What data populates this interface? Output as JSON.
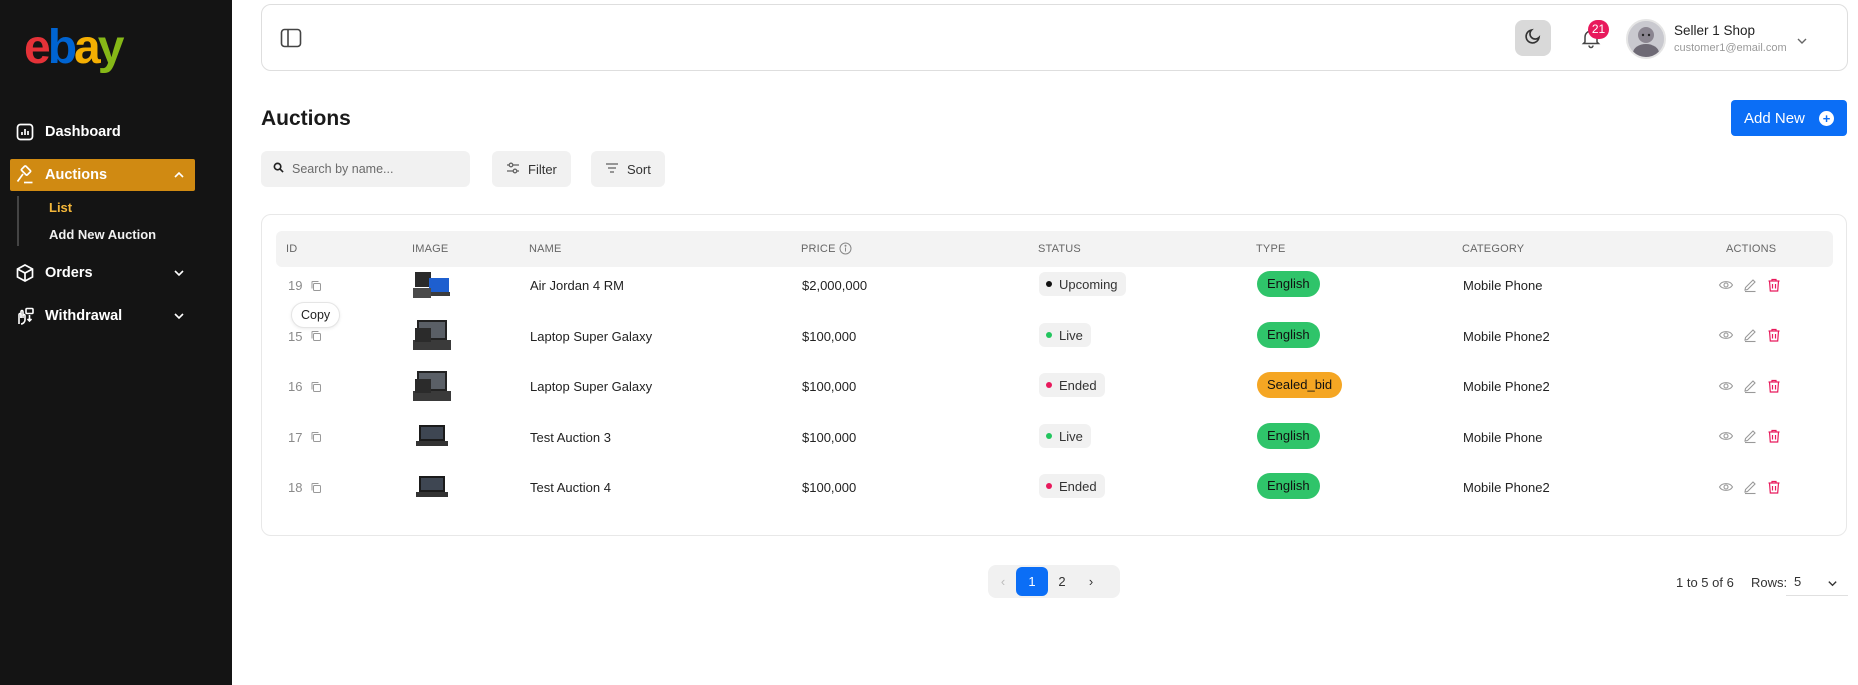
{
  "brand": {
    "logo_letters": [
      "e",
      "b",
      "a",
      "y"
    ],
    "colors": [
      "#e53238",
      "#0064d2",
      "#f5af02",
      "#86b817"
    ]
  },
  "sidebar": {
    "dashboard": "Dashboard",
    "auctions": "Auctions",
    "auctions_sub": {
      "list": "List",
      "add_new": "Add New Auction"
    },
    "orders": "Orders",
    "withdrawal": "Withdrawal"
  },
  "header": {
    "notification_count": "21",
    "user_name": "Seller 1 Shop",
    "user_email": "customer1@email.com"
  },
  "page": {
    "title": "Auctions",
    "add_button": "Add New",
    "search_placeholder": "Search by name...",
    "filter_label": "Filter",
    "sort_label": "Sort",
    "tooltip": "Copy"
  },
  "table": {
    "headers": {
      "id": "ID",
      "image": "IMAGE",
      "name": "NAME",
      "price": "PRICE",
      "status": "STATUS",
      "type": "TYPE",
      "category": "CATEGORY",
      "actions": "ACTIONS"
    },
    "rows": [
      {
        "id": "19",
        "name": "Air Jordan 4 RM",
        "price": "$2,000,000",
        "status": "Upcoming",
        "type": "English",
        "category": "Mobile Phone"
      },
      {
        "id": "15",
        "name": "Laptop Super Galaxy",
        "price": "$100,000",
        "status": "Live",
        "type": "English",
        "category": "Mobile Phone2"
      },
      {
        "id": "16",
        "name": "Laptop Super Galaxy",
        "price": "$100,000",
        "status": "Ended",
        "type": "Sealed_bid",
        "category": "Mobile Phone2"
      },
      {
        "id": "17",
        "name": "Test Auction 3",
        "price": "$100,000",
        "status": "Live",
        "type": "English",
        "category": "Mobile Phone"
      },
      {
        "id": "18",
        "name": "Test Auction 4",
        "price": "$100,000",
        "status": "Ended",
        "type": "English",
        "category": "Mobile Phone2"
      }
    ]
  },
  "status_colors": {
    "Upcoming": "#111111",
    "Live": "#22c55e",
    "Ended": "#e8195c"
  },
  "type_colors": {
    "English": "#2fc46a",
    "Sealed_bid": "#f5a623"
  },
  "pagination": {
    "prev": "‹",
    "page1": "1",
    "page2": "2",
    "next": "›",
    "count_text": "1 to 5 of 6",
    "rows_label": "Rows:",
    "rows_value": "5"
  },
  "icons": {
    "nav": [
      "dashboard-icon",
      "gavel-icon",
      "box-icon",
      "withdrawal-icon"
    ],
    "header": [
      "panel-toggle-icon",
      "moon-icon",
      "bell-icon",
      "chevron-down-icon"
    ],
    "row_actions": [
      "eye-icon",
      "pencil-icon",
      "trash-icon"
    ]
  },
  "accent": "#d08a12",
  "primary": "#0b6ef6"
}
